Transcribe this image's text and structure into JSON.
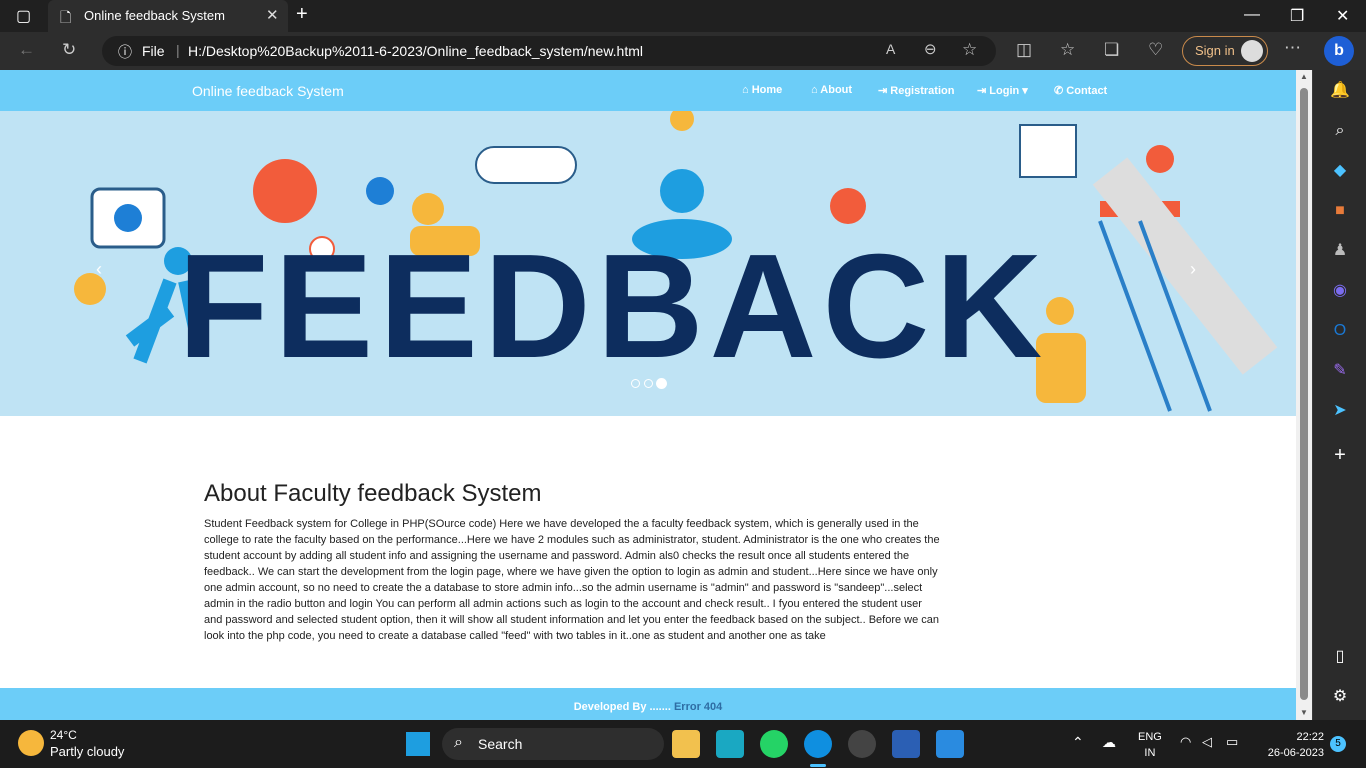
{
  "browser": {
    "tab_title": "Online feedback System",
    "file_label": "File",
    "url": "H:/Desktop%20Backup%2011-6-2023/Online_feedback_system/new.html",
    "signin_label": "Sign in"
  },
  "site": {
    "brand": "Online feedback System",
    "nav": [
      "Home",
      "About",
      "Registration",
      "Login",
      "Contact"
    ],
    "hero_word": "FEEDBACK",
    "about_title": "About Faculty feedback System",
    "about_text": "Student Feedback system for College in PHP(SOurce code) Here we have developed the a faculty feedback system, which is generally used in the college to rate the faculty based on the performance...Here we have 2 modules such as administrator, student. Administrator is the one who creates the student account by adding all student info and assigning the username and password. Admin als0 checks the result once all students entered the feedback.. We can start the development from the login page, where we have given the option to login as admin and student...Here since we have only one admin account, so no need to create the a database to store admin info...so the admin username is \"admin\" and password is \"sandeep\"...select admin in the radio button and login You can perform all admin actions such as login to the account and check result.. I fyou entered the student user and password and selected student option, then it will show all student information and let you enter the feedback based on the subject.. Before we can look into the php code, you need to create a database called \"feed\" with two tables in it..one as student and another one as take",
    "footer_prefix": "Developed By .......",
    "footer_link": "Error 404"
  },
  "taskbar": {
    "weather_temp": "24°C",
    "weather_desc": "Partly cloudy",
    "search_label": "Search",
    "lang_line1": "ENG",
    "lang_line2": "IN",
    "time": "22:22",
    "date": "26-06-2023",
    "notification_count": "5"
  },
  "colors": {
    "navbar": "#6ccdf8",
    "hero_text": "#0d2d5e",
    "footer_link": "#2e6da4"
  }
}
